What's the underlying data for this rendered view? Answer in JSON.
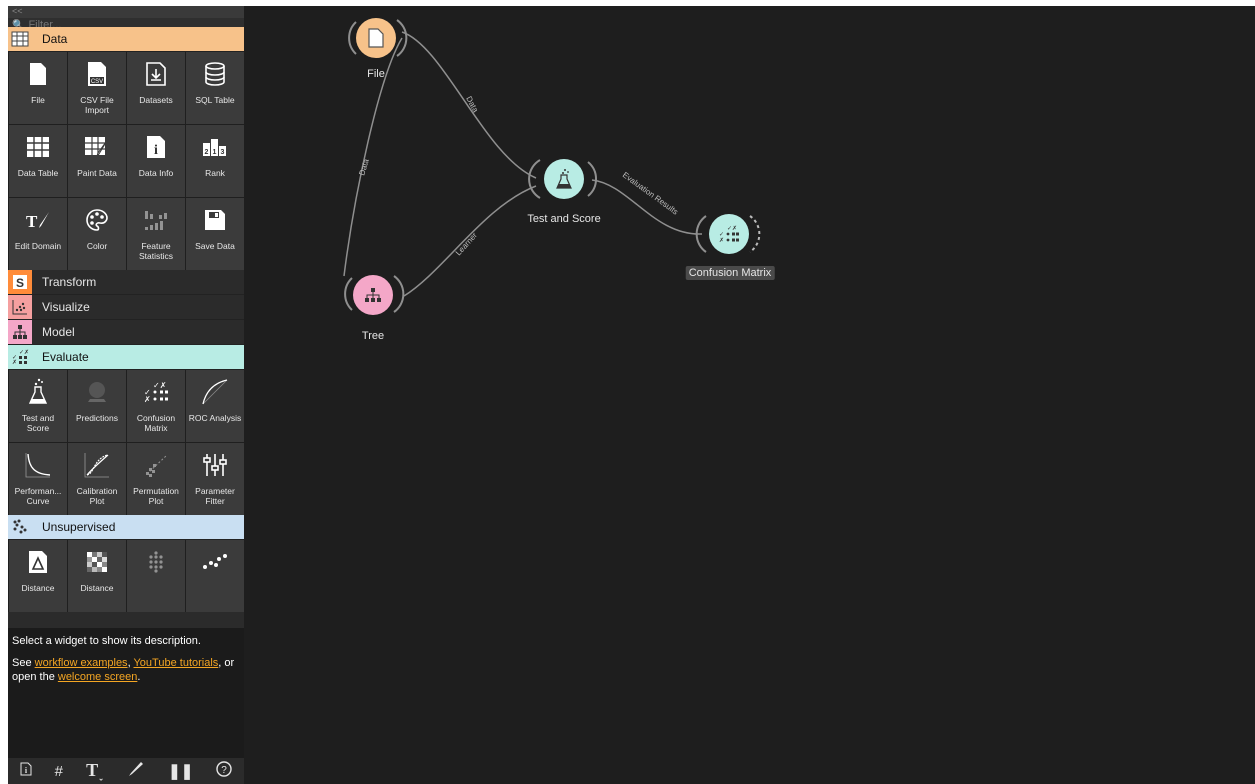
{
  "sidebar": {
    "collapse_glyph": "<<",
    "filter_placeholder": "Filter...",
    "categories": {
      "data": {
        "label": "Data",
        "color": "#f7c28a"
      },
      "transform": {
        "label": "Transform",
        "color": "#ff8c3a"
      },
      "visualize": {
        "label": "Visualize",
        "color": "#f5a0a0"
      },
      "model": {
        "label": "Model",
        "color": "#f4a7c8"
      },
      "evaluate": {
        "label": "Evaluate",
        "color": "#b8ece4"
      },
      "unsupervised": {
        "label": "Unsupervised",
        "color": "#c9dff2"
      }
    },
    "data_widgets": [
      {
        "label": "File"
      },
      {
        "label": "CSV File Import"
      },
      {
        "label": "Datasets"
      },
      {
        "label": "SQL Table"
      },
      {
        "label": "Data Table"
      },
      {
        "label": "Paint Data"
      },
      {
        "label": "Data Info"
      },
      {
        "label": "Rank"
      },
      {
        "label": "Edit Domain"
      },
      {
        "label": "Color"
      },
      {
        "label": "Feature Statistics"
      },
      {
        "label": "Save Data"
      }
    ],
    "evaluate_widgets": [
      {
        "label": "Test and Score"
      },
      {
        "label": "Predictions"
      },
      {
        "label": "Confusion Matrix"
      },
      {
        "label": "ROC Analysis"
      },
      {
        "label": "Performan... Curve"
      },
      {
        "label": "Calibration Plot"
      },
      {
        "label": "Permutation Plot"
      },
      {
        "label": "Parameter Fitter"
      }
    ],
    "unsupervised_widgets": [
      {
        "label": "Distance"
      },
      {
        "label": "Distance"
      },
      {
        "label": ""
      },
      {
        "label": ""
      }
    ],
    "description": {
      "line1": "Select a widget to show its description.",
      "see": "See ",
      "link1": "workflow examples",
      "comma": ", ",
      "link2": "YouTube tutorials",
      "or_open": ", or open the ",
      "link3": "welcome screen",
      "period": "."
    },
    "bottom_icons": [
      "info-icon",
      "grid-icon",
      "text-tool-icon",
      "pen-tool-icon",
      "pause-icon",
      "help-icon"
    ]
  },
  "canvas": {
    "nodes": {
      "file": {
        "label": "File",
        "color": "#f7c28a"
      },
      "tree": {
        "label": "Tree",
        "color": "#f4a7c8"
      },
      "test_score": {
        "label": "Test and Score",
        "color": "#b8ece4"
      },
      "confusion": {
        "label": "Confusion Matrix",
        "color": "#b8ece4"
      }
    },
    "links": {
      "file_test": "Data",
      "file_tree": "Data",
      "tree_test": "Learner",
      "test_confusion": "Evaluation Results"
    }
  }
}
